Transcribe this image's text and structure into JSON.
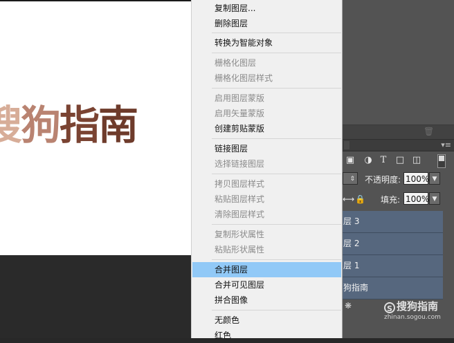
{
  "canvas": {
    "art_text_chars": [
      "搜",
      "狗",
      "指",
      "南"
    ],
    "colors": [
      "#d7ad98",
      "#b98371",
      "#7a4332",
      "#6e3b2b"
    ]
  },
  "context_menu": {
    "items": [
      {
        "label": "复制图层...",
        "enabled": true
      },
      {
        "label": "删除图层",
        "enabled": true
      },
      {
        "label": "转换为智能对象",
        "enabled": true
      },
      {
        "label": "栅格化图层",
        "enabled": false
      },
      {
        "label": "栅格化图层样式",
        "enabled": false
      },
      {
        "label": "启用图层蒙版",
        "enabled": false
      },
      {
        "label": "启用矢量蒙版",
        "enabled": false
      },
      {
        "label": "创建剪贴蒙版",
        "enabled": true
      },
      {
        "label": "链接图层",
        "enabled": true
      },
      {
        "label": "选择链接图层",
        "enabled": false
      },
      {
        "label": "拷贝图层样式",
        "enabled": false
      },
      {
        "label": "粘贴图层样式",
        "enabled": false
      },
      {
        "label": "清除图层样式",
        "enabled": false
      },
      {
        "label": "复制形状属性",
        "enabled": false
      },
      {
        "label": "粘贴形状属性",
        "enabled": false
      },
      {
        "label": "合并图层",
        "enabled": true,
        "highlighted": true
      },
      {
        "label": "合并可见图层",
        "enabled": true
      },
      {
        "label": "拼合图像",
        "enabled": true
      },
      {
        "label": "无颜色",
        "enabled": true
      },
      {
        "label": "红色",
        "enabled": true
      }
    ],
    "highlight_color": "#91c9f7"
  },
  "layers_panel": {
    "opacity_label": "不透明度:",
    "opacity_value": "100%",
    "fill_label": "填充:",
    "fill_value": "100%",
    "layers": [
      {
        "name_visible": "层 3",
        "selected": true
      },
      {
        "name_visible": "层 2",
        "selected": true
      },
      {
        "name_visible": "层 1",
        "selected": true
      },
      {
        "name_visible": "狗指南",
        "selected": true
      }
    ],
    "selected_color": "#56677e",
    "icons": [
      "image-icon",
      "circle-adjust-icon",
      "type-icon",
      "transform-icon",
      "smart-object-icon",
      "toggle-icon"
    ]
  },
  "watermark": {
    "main": "搜狗指南",
    "sub": "zhinan.sogou.com"
  }
}
